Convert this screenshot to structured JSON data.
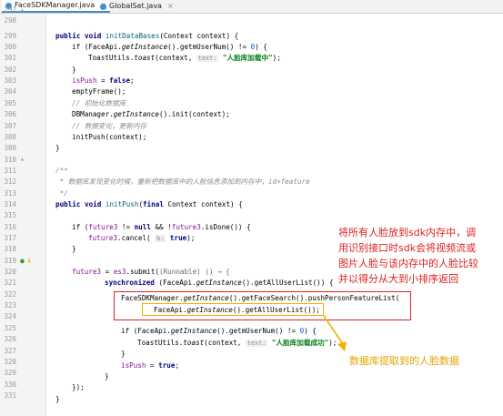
{
  "tabs": [
    {
      "label": "FaceSDKManager.java",
      "active": true
    },
    {
      "label": "GlobalSet.java",
      "active": false
    }
  ],
  "gutter": {
    "line_numbers": [
      "297",
      "298",
      "299",
      "300",
      "301",
      "302",
      "303",
      "304",
      "305",
      "306",
      "307",
      "308",
      "309",
      "310",
      "311",
      "312",
      "313",
      "314",
      "315",
      "316",
      "317",
      "318",
      "319",
      "320",
      "321",
      "322",
      "323",
      "324",
      "325",
      "326",
      "327",
      "328",
      "329",
      "330",
      "331"
    ]
  },
  "code": {
    "l299_a": "public void ",
    "l299_b": "initDataBases",
    "l299_c": "(Context context) {",
    "l300_a": "if (FaceApi.",
    "l300_b": "getInstance",
    "l300_c": "().getmUserNum() != ",
    "l300_d": "0",
    "l300_e": ") {",
    "l301_a": "ToastUtils.",
    "l301_b": "toast",
    "l301_c": "(context, ",
    "l301_hint": "text:",
    "l301_str": "\"人脸库加载中\"",
    "l301_d": ");",
    "l302": "}",
    "l303_a": "isPush",
    "l303_b": " = ",
    "l303_c": "false",
    "l303_d": ";",
    "l304": "emptyFrame();",
    "l305": "// 初始化数据库",
    "l306_a": "DBManager.",
    "l306_b": "getInstance",
    "l306_c": "().init(context);",
    "l307": "// 数据变化，更新内存",
    "l308": "initPush(context);",
    "l309": "}",
    "l311": "/**",
    "l312": " * 数据库发现变化时候，重新把数据库中的人脸信息添加到内存中，id+feature",
    "l313": " */",
    "l314_a": "public void ",
    "l314_b": "initPush",
    "l314_c": "(",
    "l314_d": "final ",
    "l314_e": "Context context) {",
    "l316_a": "if (",
    "l316_b": "future3",
    "l316_c": " != ",
    "l316_d": "null",
    "l316_e": " && !",
    "l316_f": "future3",
    "l316_g": ".isDone()) {",
    "l317_a": "future3",
    "l317_b": ".cancel( ",
    "l317_hint": "b:",
    "l317_c": " true",
    "l317_d": ");",
    "l318": "}",
    "l320_a": "future3",
    "l320_b": " = ",
    "l320_c": "es3",
    "l320_d": ".submit(",
    "l320_e": "(Runnable) () → {",
    "l321_a": "synchronized",
    "l321_b": " (FaceApi.",
    "l321_c": "getInstance",
    "l321_d": "().getAllUserList()) {",
    "l322_a": "FaceSDKManager.",
    "l322_b": "getInstance",
    "l322_c": "().getFaceSearch().pushPersonFeatureList(",
    "l323_a": "FaceApi.",
    "l323_b": "getInstance",
    "l323_c": "().getAllUserList());",
    "l325_a": "if (FaceApi.",
    "l325_b": "getInstance",
    "l325_c": "().getmUserNum() != ",
    "l325_d": "0",
    "l325_e": ") {",
    "l326_a": "ToastUtils.",
    "l326_b": "toast",
    "l326_c": "(context, ",
    "l326_hint": "text:",
    "l326_str": "\"人脸库加载成功\"",
    "l326_d": ");",
    "l327": "}",
    "l328_a": "isPush",
    "l328_b": " = ",
    "l328_c": "true",
    "l328_d": ";",
    "l329": "}",
    "l330": "});",
    "l331": "}"
  },
  "annotations": {
    "red_note": "将所有人脸放到sdk内存中，调\n用识别接口时sdk会将视频流或\n图片人脸与该内存中的人脸比较\n并以得分从大到小排序返回",
    "yellow_note": "数据库提取到的人脸数据"
  },
  "colors": {
    "red": "#e02020",
    "yellow": "#f0b400",
    "keyword": "#000080",
    "string": "#067d17",
    "field": "#871094"
  }
}
